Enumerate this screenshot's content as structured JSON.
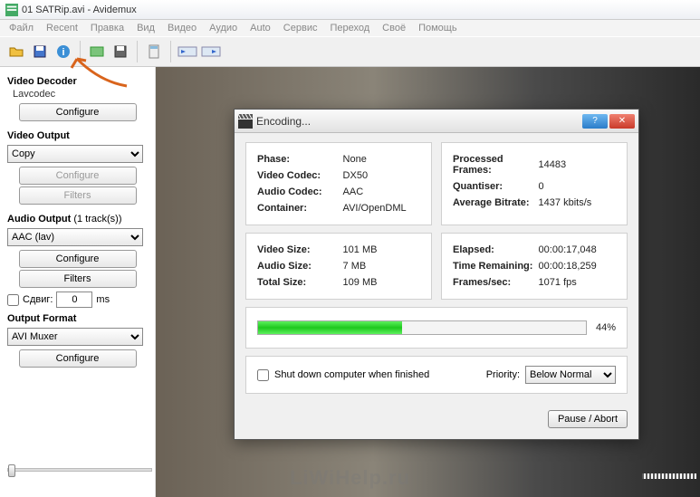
{
  "window": {
    "title": "01 SATRip.avi - Avidemux"
  },
  "menu": [
    "Файл",
    "Recent",
    "Правка",
    "Вид",
    "Видео",
    "Аудио",
    "Auto",
    "Сервис",
    "Переход",
    "Своё",
    "Помощь"
  ],
  "toolbar_icons": [
    "folder-open-icon",
    "save-disk-icon",
    "info-icon",
    "picture-icon",
    "floppy-icon",
    "calculator-icon",
    "play-range-icon",
    "play-icon"
  ],
  "sidebar": {
    "video_decoder": {
      "title": "Video Decoder",
      "codec": "Lavcodec",
      "configure": "Configure"
    },
    "video_output": {
      "title": "Video Output",
      "value": "Copy",
      "configure": "Configure",
      "filters": "Filters"
    },
    "audio_output": {
      "title": "Audio Output",
      "tracks": "(1 track(s))",
      "value": "AAC (lav)",
      "configure": "Configure",
      "filters": "Filters",
      "shift_label": "Сдвиг:",
      "shift_value": "0",
      "shift_unit": "ms"
    },
    "output_format": {
      "title": "Output Format",
      "value": "AVI Muxer",
      "configure": "Configure"
    }
  },
  "dialog": {
    "title": "Encoding...",
    "left1": {
      "phase_k": "Phase:",
      "phase_v": "None",
      "vcodec_k": "Video Codec:",
      "vcodec_v": "DX50",
      "acodec_k": "Audio Codec:",
      "acodec_v": "AAC",
      "container_k": "Container:",
      "container_v": "AVI/OpenDML"
    },
    "right1": {
      "pframes_k": "Processed Frames:",
      "pframes_v": "14483",
      "quant_k": "Quantiser:",
      "quant_v": "0",
      "abit_k": "Average Bitrate:",
      "abit_v": "1437 kbits/s"
    },
    "left2": {
      "vsize_k": "Video Size:",
      "vsize_v": "101 MB",
      "asize_k": "Audio Size:",
      "asize_v": "7 MB",
      "tsize_k": "Total Size:",
      "tsize_v": "109 MB"
    },
    "right2": {
      "elapsed_k": "Elapsed:",
      "elapsed_v": "00:00:17,048",
      "remain_k": "Time Remaining:",
      "remain_v": "00:00:18,259",
      "fps_k": "Frames/sec:",
      "fps_v": "1071 fps"
    },
    "progress_pct": "44%",
    "shutdown_label": "Shut down computer when finished",
    "priority_label": "Priority:",
    "priority_value": "Below Normal",
    "pause_abort": "Pause / Abort"
  },
  "watermark": "LiWiHelp.ru"
}
